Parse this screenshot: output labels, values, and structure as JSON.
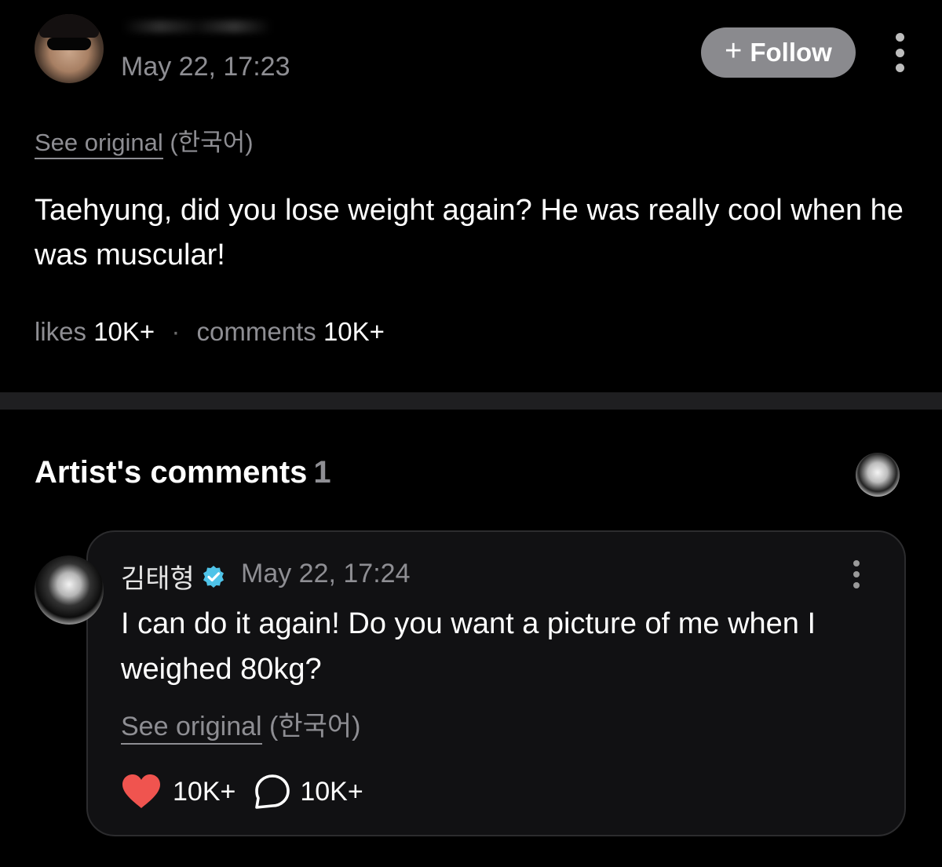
{
  "post": {
    "timestamp": "May 22, 17:23",
    "follow_label": "Follow",
    "see_original": {
      "link": "See original",
      "language": "(한국어)"
    },
    "body": "Taehyung, did you lose weight again? He was really cool when he was muscular!",
    "stats": {
      "likes_label": "likes",
      "likes_value": "10K+",
      "separator": "·",
      "comments_label": "comments",
      "comments_value": "10K+"
    }
  },
  "artist_comments": {
    "title": "Artist's comments",
    "count": "1",
    "comment": {
      "author": "김태형",
      "timestamp": "May 22, 17:24",
      "body": "I can do it again! Do you want a picture of me when I weighed 80kg?",
      "see_original": {
        "link": "See original",
        "language": "(한국어)"
      },
      "likes": "10K+",
      "replies": "10K+"
    }
  },
  "colors": {
    "background": "#000000",
    "muted_text": "#8e8e93",
    "follow_button": "#8a8a8e",
    "verified": "#4fc3e8",
    "heart": "#f0544f",
    "card_background": "#111113",
    "divider": "#1f1f21"
  },
  "icons": {
    "follow": "plus-icon",
    "menu": "more-vertical-icon",
    "verified": "verified-badge-icon",
    "like": "heart-icon",
    "reply": "comment-bubble-icon"
  }
}
